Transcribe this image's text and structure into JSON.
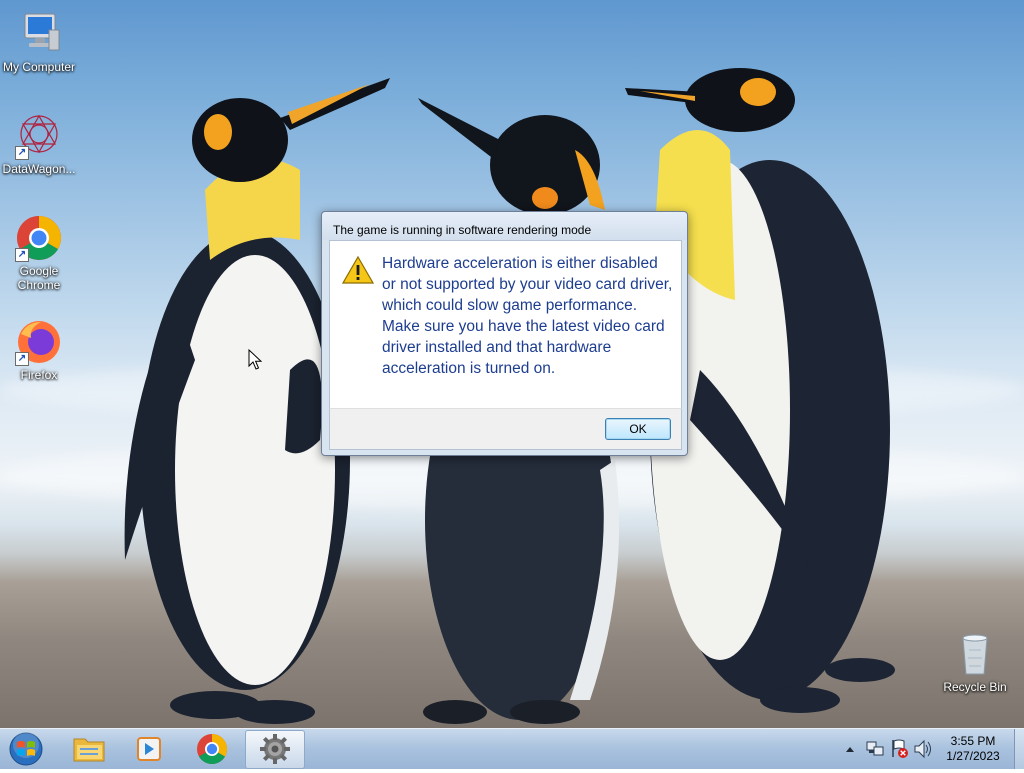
{
  "desktop": {
    "icons": [
      {
        "label": "My Computer"
      },
      {
        "label": "DataWagon..."
      },
      {
        "label": "Google Chrome"
      },
      {
        "label": "Firefox"
      },
      {
        "label": "Recycle Bin"
      }
    ]
  },
  "dialog": {
    "title": "The game is running in software rendering mode",
    "message": "Hardware acceleration is either disabled or not supported by your video card driver, which could slow game performance. Make sure you have the latest video card driver installed and that hardware acceleration is turned on.",
    "ok_label": "OK",
    "icon": "warning-icon"
  },
  "taskbar": {
    "pinned": [
      {
        "name": "file-explorer-icon"
      },
      {
        "name": "media-player-icon"
      },
      {
        "name": "chrome-icon"
      },
      {
        "name": "game-settings-icon",
        "active": true
      }
    ],
    "tray_icons": [
      "show-hidden-icons-chevron",
      "network-icon",
      "action-center-flag-icon",
      "volume-icon"
    ],
    "time": "3:55 PM",
    "date": "1/27/2023"
  },
  "colors": {
    "dialog_text": "#1d3d8f",
    "taskbar": "#a8c1de"
  }
}
